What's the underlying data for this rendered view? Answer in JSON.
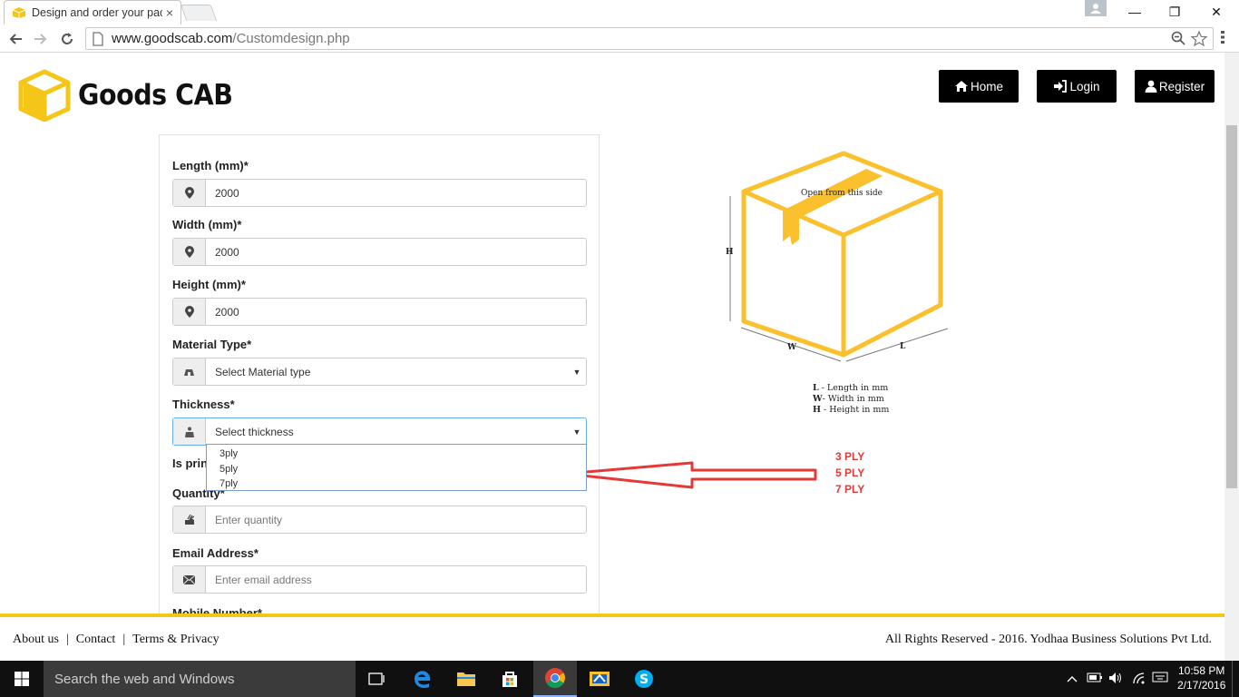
{
  "browser": {
    "tab_title": "Design and order your pac",
    "tab_close": "×",
    "url_host": "www.goodscab.com",
    "url_path": "/Customdesign.php",
    "window_min": "—",
    "window_restore": "❐",
    "window_close": "✕"
  },
  "brand": {
    "name": "Goods CAB",
    "accent_color": "#f5c518"
  },
  "nav": {
    "home": "Home",
    "login": "Login",
    "register": "Register"
  },
  "form": {
    "length_label": "Length (mm)*",
    "length_value": "2000",
    "width_label": "Width (mm)*",
    "width_value": "2000",
    "height_label": "Height (mm)*",
    "height_value": "2000",
    "material_label": "Material Type*",
    "material_value": "Select Material type",
    "thickness_label": "Thickness*",
    "thickness_value": "Select thickness",
    "thickness_options": [
      "3ply",
      "5ply",
      "7ply"
    ],
    "printing_label_partial": "Is prin",
    "quantity_label": "Quantity*",
    "quantity_placeholder": "Enter quantity",
    "email_label": "Email Address*",
    "email_placeholder": "Enter email address",
    "mobile_label": "Mobile Number*"
  },
  "diagram": {
    "top_text": "Open from this side",
    "h": "H",
    "w": "W",
    "l": "L",
    "legend_l_key": "L",
    "legend_l": " - Length in mm",
    "legend_w_key": "W",
    "legend_w": "- Width in mm",
    "legend_h_key": "H",
    "legend_h": " - Height in mm"
  },
  "annotation": {
    "labels": [
      "3 PLY",
      "5 PLY",
      "7 PLY"
    ],
    "color": "#e53935"
  },
  "footer": {
    "about": "About us",
    "contact": "Contact",
    "terms": "Terms & Privacy",
    "separator": "|",
    "copyright": "All Rights Reserved - 2016. Yodhaa Business Solutions Pvt Ltd."
  },
  "taskbar": {
    "search_placeholder": "Search the web and Windows",
    "time": "10:58 PM",
    "date": "2/17/2016"
  }
}
